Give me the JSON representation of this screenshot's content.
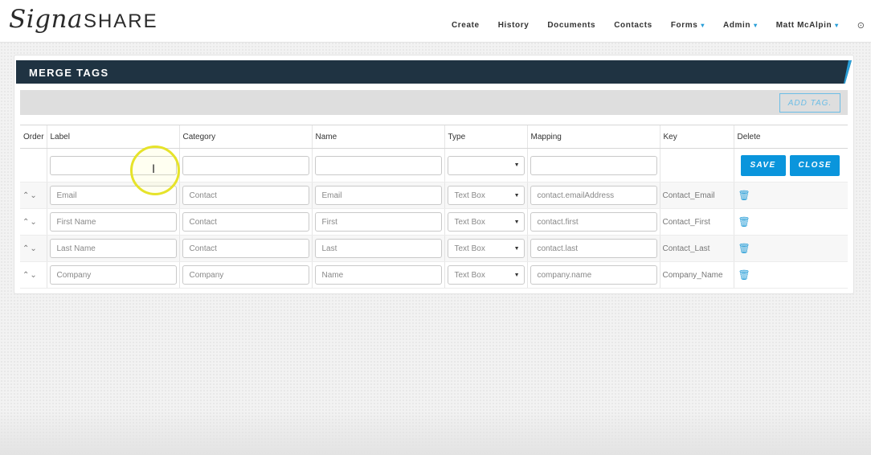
{
  "logo": {
    "script": "Signa",
    "caps": "SHARE"
  },
  "nav": {
    "items": [
      {
        "label": "Create"
      },
      {
        "label": "History"
      },
      {
        "label": "Documents"
      },
      {
        "label": "Contacts"
      },
      {
        "label": "Forms",
        "dropdown": true
      },
      {
        "label": "Admin",
        "dropdown": true
      },
      {
        "label": "Matt McAlpin",
        "dropdown": true
      }
    ],
    "caret": "▾",
    "gear_icon": "gear-icon"
  },
  "panel": {
    "title": "MERGE TAGS",
    "add_tag_label": "ADD TAG."
  },
  "table": {
    "columns": [
      "Order",
      "Label",
      "Category",
      "Name",
      "Type",
      "Mapping",
      "Key",
      "Delete"
    ],
    "new_row": {
      "label": "",
      "category": "",
      "name": "",
      "type": "",
      "mapping": ""
    },
    "save_label": "SAVE",
    "close_label": "CLOSE",
    "rows": [
      {
        "order": "⌃⌄",
        "label": "Email",
        "category": "Contact",
        "name": "Email",
        "type": "Text Box",
        "mapping": "contact.emailAddress",
        "key": "Contact_Email"
      },
      {
        "order": "⌃⌄",
        "label": "First Name",
        "category": "Contact",
        "name": "First",
        "type": "Text Box",
        "mapping": "contact.first",
        "key": "Contact_First"
      },
      {
        "order": "⌃⌄",
        "label": "Last Name",
        "category": "Contact",
        "name": "Last",
        "type": "Text Box",
        "mapping": "contact.last",
        "key": "Contact_Last"
      },
      {
        "order": "⌃⌄",
        "label": "Company",
        "category": "Company",
        "name": "Name",
        "type": "Text Box",
        "mapping": "company.name",
        "key": "Company_Name"
      }
    ]
  },
  "colors": {
    "header_bg": "#1f3342",
    "accent": "#2a9fd8",
    "button": "#0a95dc"
  }
}
